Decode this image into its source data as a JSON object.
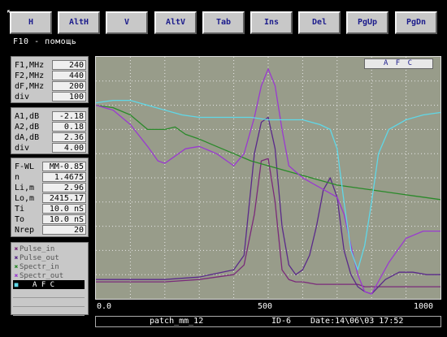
{
  "toolbar": {
    "buttons": [
      {
        "label": "H",
        "underline": ""
      },
      {
        "label": "AltH",
        "underline": "H"
      },
      {
        "label": "V",
        "underline": ""
      },
      {
        "label": "AltV",
        "underline": "V"
      },
      {
        "label": "Tab",
        "underline": "T"
      },
      {
        "label": "Ins",
        "underline": "I"
      },
      {
        "label": "Del",
        "underline": "D"
      },
      {
        "label": "PgUp",
        "underline": "P"
      },
      {
        "label": "PgDn",
        "underline": "P"
      }
    ]
  },
  "help_text": "F10 - помощь",
  "freq_panel": [
    {
      "label": "F1,MHz",
      "value": "240"
    },
    {
      "label": "F2,MHz",
      "value": "440"
    },
    {
      "label": "dF,MHz",
      "value": "200"
    },
    {
      "label": "div",
      "value": "100"
    }
  ],
  "ampl_panel": [
    {
      "label": "A1,dB",
      "value": "-2.18"
    },
    {
      "label": "A2,dB",
      "value": "0.18"
    },
    {
      "label": "dA,dB",
      "value": "2.36"
    },
    {
      "label": "div",
      "value": "4.00"
    }
  ],
  "fiber_panel": [
    {
      "label": "F-WL",
      "value": "MM-0.85"
    },
    {
      "label": "n",
      "value": "1.4675"
    },
    {
      "label": "Li,m",
      "value": "2.96"
    },
    {
      "label": "Lo,m",
      "value": "2415.17"
    },
    {
      "label": "Ti",
      "value": "10.0 nS"
    },
    {
      "label": "To",
      "value": "10.0 nS"
    },
    {
      "label": "Nrep",
      "value": "20"
    }
  ],
  "plot": {
    "afc_label": "A F C",
    "x_ticks": [
      "0.0",
      "500",
      "1000"
    ],
    "background": "#989c8a"
  },
  "chart_data": {
    "type": "line",
    "title": "A F C",
    "xlim": [
      0,
      1000
    ],
    "ylim": [
      0,
      100
    ],
    "grid": true,
    "series": [
      {
        "name": "Pulse_in",
        "color": "#7a2a7a",
        "x": [
          0,
          100,
          200,
          300,
          400,
          430,
          460,
          480,
          500,
          520,
          540,
          560,
          580,
          600,
          640,
          680,
          700,
          720,
          740,
          760,
          780,
          800,
          850,
          900,
          950,
          1000
        ],
        "y": [
          7,
          7,
          7,
          8,
          10,
          14,
          35,
          57,
          58,
          40,
          12,
          8,
          7,
          7,
          6,
          6,
          6,
          6,
          6,
          6,
          5,
          5,
          5,
          5,
          5,
          5
        ]
      },
      {
        "name": "Pulse_out",
        "color": "#5a2a8a",
        "x": [
          0,
          100,
          200,
          300,
          400,
          430,
          460,
          480,
          500,
          520,
          540,
          560,
          580,
          600,
          620,
          640,
          660,
          680,
          700,
          720,
          740,
          760,
          780,
          800,
          840,
          880,
          920,
          960,
          1000
        ],
        "y": [
          8,
          8,
          8,
          9,
          12,
          18,
          60,
          73,
          75,
          62,
          30,
          14,
          10,
          12,
          18,
          30,
          45,
          50,
          42,
          20,
          10,
          5,
          3,
          2,
          8,
          11,
          11,
          10,
          10
        ]
      },
      {
        "name": "Spectr_in",
        "color": "#2a8a2a",
        "x": [
          0,
          50,
          100,
          150,
          200,
          230,
          260,
          300,
          350,
          400,
          450,
          500,
          550,
          600,
          650,
          700,
          750,
          800,
          850,
          900,
          950,
          1000
        ],
        "y": [
          80,
          79,
          76,
          70,
          70,
          71,
          68,
          66,
          63,
          60,
          57,
          55,
          53,
          51,
          49,
          47,
          46,
          45,
          44,
          43,
          42,
          41
        ]
      },
      {
        "name": "Spectr_out",
        "color": "#9a3ad0",
        "x": [
          0,
          50,
          100,
          150,
          180,
          200,
          230,
          260,
          300,
          350,
          400,
          430,
          460,
          480,
          500,
          520,
          540,
          560,
          600,
          650,
          700,
          720,
          740,
          760,
          780,
          800,
          850,
          900,
          950,
          1000
        ],
        "y": [
          80,
          78,
          72,
          63,
          57,
          56,
          59,
          62,
          63,
          60,
          55,
          60,
          75,
          88,
          95,
          88,
          70,
          55,
          50,
          46,
          42,
          35,
          22,
          10,
          3,
          2,
          15,
          25,
          28,
          28
        ]
      },
      {
        "name": "A F C",
        "color": "#5fd8e8",
        "x": [
          0,
          50,
          100,
          150,
          200,
          250,
          300,
          350,
          400,
          450,
          500,
          550,
          600,
          650,
          680,
          700,
          720,
          740,
          760,
          780,
          800,
          820,
          850,
          900,
          950,
          1000
        ],
        "y": [
          81,
          82,
          82,
          80,
          78,
          76,
          75,
          75,
          75,
          75,
          74,
          74,
          74,
          72,
          70,
          62,
          40,
          20,
          12,
          22,
          40,
          60,
          70,
          74,
          76,
          77
        ]
      }
    ]
  },
  "legend": {
    "items": [
      {
        "label": "Pulse_in",
        "color": "#7a2a7a",
        "mark": "✖"
      },
      {
        "label": "Pulse_out",
        "color": "#5a2a8a",
        "mark": "✖"
      },
      {
        "label": "Spectr_in",
        "color": "#2a8a2a",
        "mark": "✖"
      },
      {
        "label": "Spectr_out",
        "color": "#9a3ad0",
        "mark": "✖"
      },
      {
        "label": "A F C",
        "color": "#5fd8e8",
        "mark": "■"
      }
    ]
  },
  "status_bar": {
    "filename": "patch_mm_12",
    "id": "ID-6",
    "date": "Date:14\\06\\03 17:52"
  }
}
